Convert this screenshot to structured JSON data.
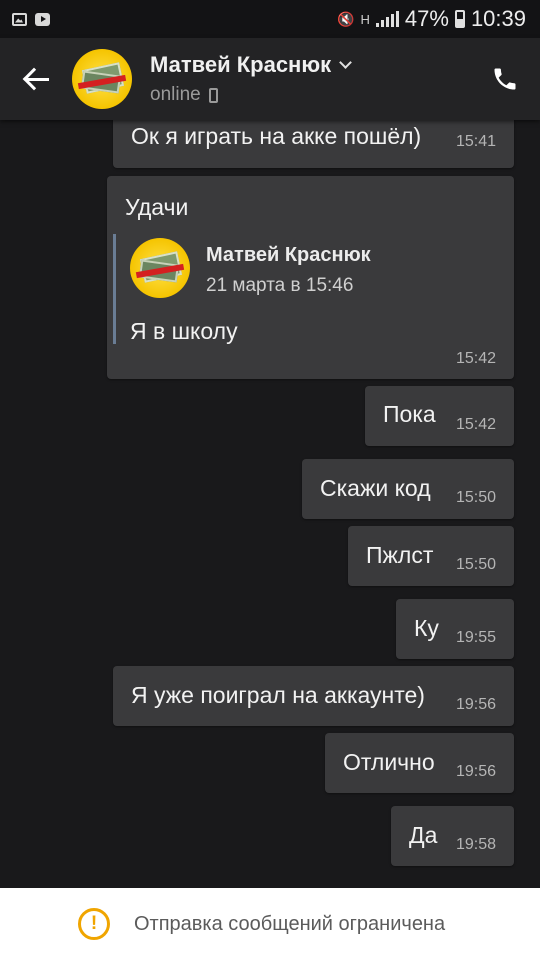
{
  "statusbar": {
    "net_type": "H",
    "battery": "47%",
    "time": "10:39"
  },
  "header": {
    "contact_name": "Матвей Краснюк",
    "status": "online"
  },
  "messages": [
    {
      "text": "Ок я играть на акке пошёл)",
      "time": "15:41"
    },
    {
      "text": "Удачи",
      "time": "15:42",
      "reply": {
        "name": "Матвей Краснюк",
        "date": "21 марта в 15:46",
        "text": "Я в школу"
      }
    },
    {
      "text": "Пока",
      "time": "15:42"
    },
    {
      "text": "Скажи код",
      "time": "15:50"
    },
    {
      "text": "Пжлст",
      "time": "15:50"
    },
    {
      "text": "Ку",
      "time": "19:55"
    },
    {
      "text": "Я уже поиграл на аккаунте)",
      "time": "19:56"
    },
    {
      "text": "Отлично",
      "time": "19:56"
    },
    {
      "text": "Да",
      "time": "19:58"
    }
  ],
  "footer": {
    "notice": "Отправка сообщений ограничена"
  },
  "colors": {
    "background": "#19191b",
    "bubble": "#3a3a3c",
    "header": "#232325",
    "warning": "#f0a500"
  }
}
